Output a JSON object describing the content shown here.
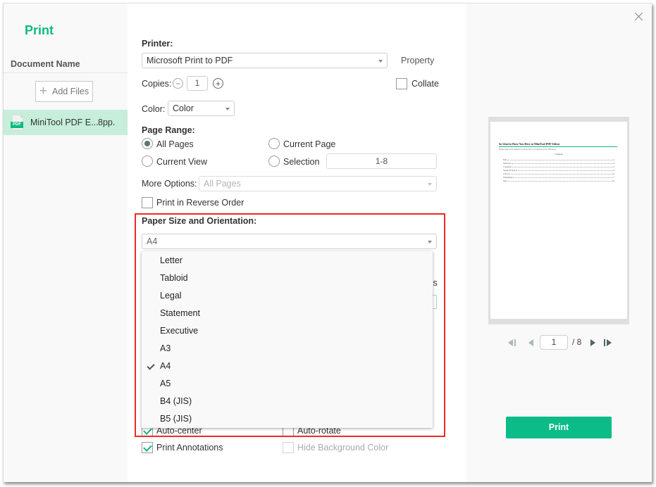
{
  "window": {
    "title": "Print",
    "close_icon": "close-icon"
  },
  "sidebar": {
    "document_name_header": "Document Name",
    "add_files_label": "Add Files",
    "documents": [
      {
        "icon": "pdf-file-icon",
        "icon_badge": "PDF",
        "name": "MiniTool PDF E...",
        "pages": "8pp."
      }
    ]
  },
  "printer": {
    "label": "Printer:",
    "selected": "Microsoft Print to PDF",
    "property_label": "Property"
  },
  "copies": {
    "label": "Copies:",
    "value": "1",
    "collate_label": "Collate",
    "collate_checked": false
  },
  "color": {
    "label": "Color:",
    "selected": "Color"
  },
  "page_range": {
    "label": "Page Range:",
    "options": [
      {
        "label": "All Pages",
        "checked": true
      },
      {
        "label": "Current Page",
        "checked": false
      },
      {
        "label": "Current View",
        "checked": false
      },
      {
        "label": "Selection",
        "checked": false
      }
    ],
    "selection_value": "1-8",
    "more_options_label": "More Options:",
    "more_options_selected": "All Pages",
    "reverse_order_label": "Print in Reverse Order",
    "reverse_order_checked": false
  },
  "paper": {
    "label": "Paper Size and Orientation:",
    "selected": "A4",
    "dropdown_options": [
      {
        "label": "Letter",
        "selected": false
      },
      {
        "label": "Tabloid",
        "selected": false
      },
      {
        "label": "Legal",
        "selected": false
      },
      {
        "label": "Statement",
        "selected": false
      },
      {
        "label": "Executive",
        "selected": false
      },
      {
        "label": "A3",
        "selected": false
      },
      {
        "label": "A4",
        "selected": true
      },
      {
        "label": "A5",
        "selected": false
      },
      {
        "label": "B4 (JIS)",
        "selected": false
      },
      {
        "label": "B5 (JIS)",
        "selected": false
      }
    ],
    "partially_hidden_text": "ıs"
  },
  "options": {
    "auto_center_label": "Auto-center",
    "auto_center_checked": true,
    "auto_rotate_label": "Auto-rotate",
    "auto_rotate_checked": false,
    "print_annotations_label": "Print Annotations",
    "print_annotations_checked": true,
    "hide_background_label": "Hide Background Color",
    "hide_background_checked": false
  },
  "preview": {
    "doc_title": "So Glad to Have You Here at MiniTool PDF Editor",
    "doc_subtitle": "Please take a few minutes to know how we improve your efficiency",
    "content_heading": "Content",
    "toc": [
      {
        "title": "Edit",
        "page": "2"
      },
      {
        "title": "Annotate",
        "page": "3"
      },
      {
        "title": "Compress",
        "page": "3"
      },
      {
        "title": "Merge & Split",
        "page": "4"
      },
      {
        "title": "Convert",
        "page": "6"
      },
      {
        "title": "Watermark",
        "page": "7"
      },
      {
        "title": "Sign",
        "page": "8"
      }
    ],
    "current_page": "1",
    "total_pages": "/ 8"
  },
  "actions": {
    "print_label": "Print"
  },
  "colors": {
    "brand": "#10b981",
    "print_button": "#0bbc88",
    "selected_doc_bg": "#c6eedb",
    "highlight_border": "#ee2a24"
  }
}
